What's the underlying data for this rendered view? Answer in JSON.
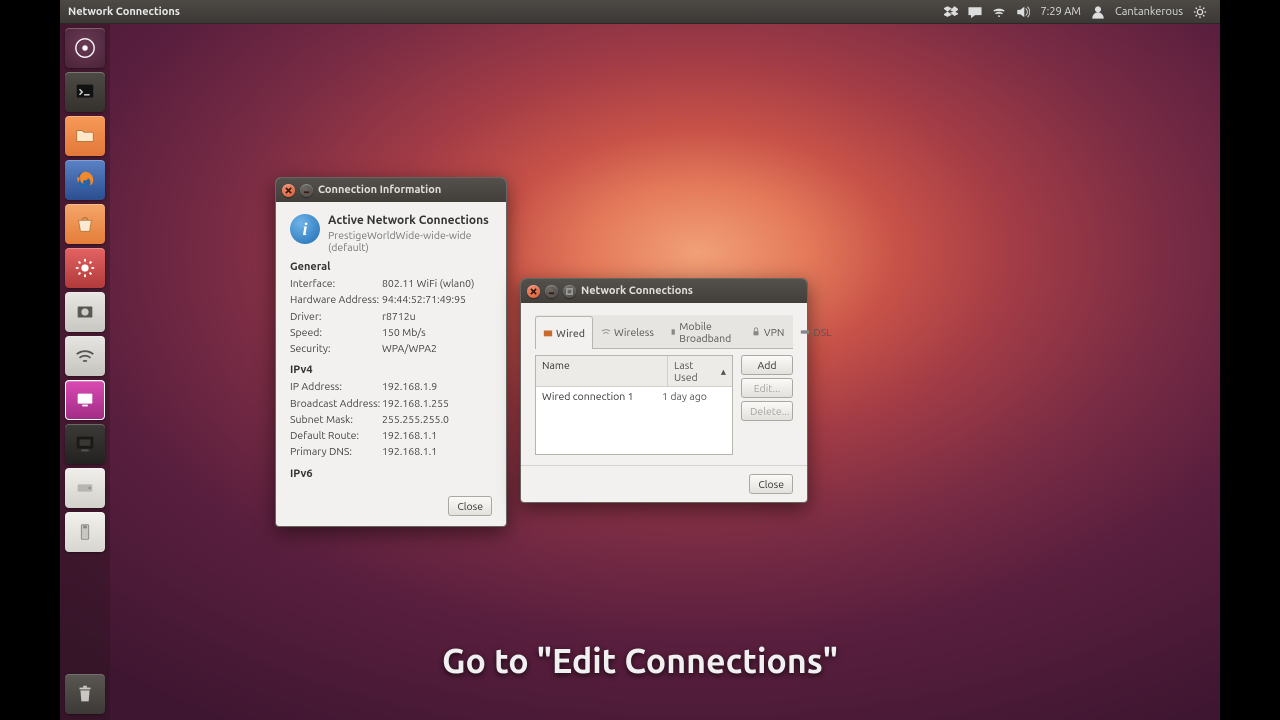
{
  "menubar": {
    "title": "Network Connections",
    "time": "7:29 AM",
    "user": "Cantankerous"
  },
  "launcher": {
    "items": [
      "dash",
      "terminal",
      "files",
      "firefox",
      "software-center",
      "gear",
      "drives",
      "wifi",
      "remote",
      "system-settings",
      "internal-drive",
      "external-media"
    ],
    "trash": "trash"
  },
  "conn_info": {
    "title": "Connection Information",
    "heading": "Active Network Connections",
    "connection_name": "PrestigeWorldWide-wide-wide (default)",
    "sections": {
      "general": {
        "label": "General",
        "interface": {
          "k": "Interface:",
          "v": "802.11 WiFi (wlan0)"
        },
        "hwaddr": {
          "k": "Hardware Address:",
          "v": "94:44:52:71:49:95"
        },
        "driver": {
          "k": "Driver:",
          "v": "r8712u"
        },
        "speed": {
          "k": "Speed:",
          "v": "150 Mb/s"
        },
        "security": {
          "k": "Security:",
          "v": "WPA/WPA2"
        }
      },
      "ipv4": {
        "label": "IPv4",
        "ip": {
          "k": "IP Address:",
          "v": "192.168.1.9"
        },
        "bcast": {
          "k": "Broadcast Address:",
          "v": "192.168.1.255"
        },
        "mask": {
          "k": "Subnet Mask:",
          "v": "255.255.255.0"
        },
        "route": {
          "k": "Default Route:",
          "v": "192.168.1.1"
        },
        "dns": {
          "k": "Primary DNS:",
          "v": "192.168.1.1"
        }
      },
      "ipv6": {
        "label": "IPv6"
      }
    },
    "close": "Close"
  },
  "net_conn": {
    "title": "Network Connections",
    "tabs": {
      "wired": "Wired",
      "wireless": "Wireless",
      "mobile": "Mobile Broadband",
      "vpn": "VPN",
      "dsl": "DSL"
    },
    "columns": {
      "name": "Name",
      "last_used": "Last Used"
    },
    "rows": [
      {
        "name": "Wired connection 1",
        "last_used": "1 day ago"
      }
    ],
    "buttons": {
      "add": "Add",
      "edit": "Edit...",
      "delete": "Delete..."
    },
    "close": "Close"
  },
  "caption": "Go to \"Edit Connections\""
}
